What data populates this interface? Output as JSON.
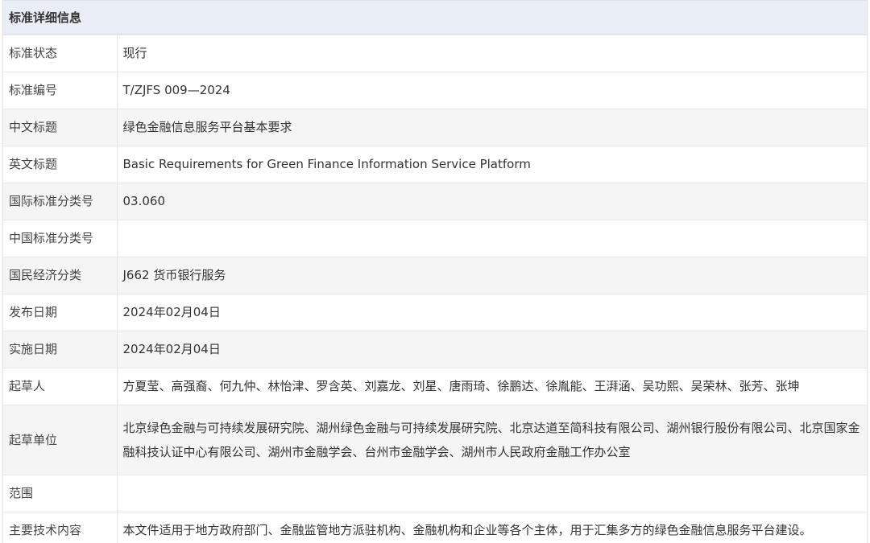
{
  "header": {
    "title": "标准详细信息"
  },
  "rows": [
    {
      "label": "标准状态",
      "value": "现行"
    },
    {
      "label": "标准编号",
      "value": "T/ZJFS 009—2024"
    },
    {
      "label": "中文标题",
      "value": "绿色金融信息服务平台基本要求"
    },
    {
      "label": "英文标题",
      "value": "Basic Requirements for Green Finance Information Service Platform"
    },
    {
      "label": "国际标准分类号",
      "value": "03.060"
    },
    {
      "label": "中国标准分类号",
      "value": ""
    },
    {
      "label": "国民经济分类",
      "value": "J662 货币银行服务"
    },
    {
      "label": "发布日期",
      "value": "2024年02月04日"
    },
    {
      "label": "实施日期",
      "value": "2024年02月04日"
    },
    {
      "label": "起草人",
      "value": "方夏莹、高强裔、何九仲、林怡津、罗含英、刘嘉龙、刘星、唐雨琦、徐鹏达、徐胤能、王湃涵、吴功熙、吴荣林、张芳、张坤"
    },
    {
      "label": "起草单位",
      "value": "北京绿色金融与可持续发展研究院、湖州绿色金融与可持续发展研究院、北京达道至简科技有限公司、湖州银行股份有限公司、北京国家金融科技认证中心有限公司、湖州市金融学会、台州市金融学会、湖州市人民政府金融工作办公室"
    },
    {
      "label": "范围",
      "value": ""
    },
    {
      "label": "主要技术内容",
      "value": "本文件适用于地方政府部门、金融监管地方派驻机构、金融机构和企业等各个主体，用于汇集多方的绿色金融信息服务平台建设。"
    }
  ]
}
